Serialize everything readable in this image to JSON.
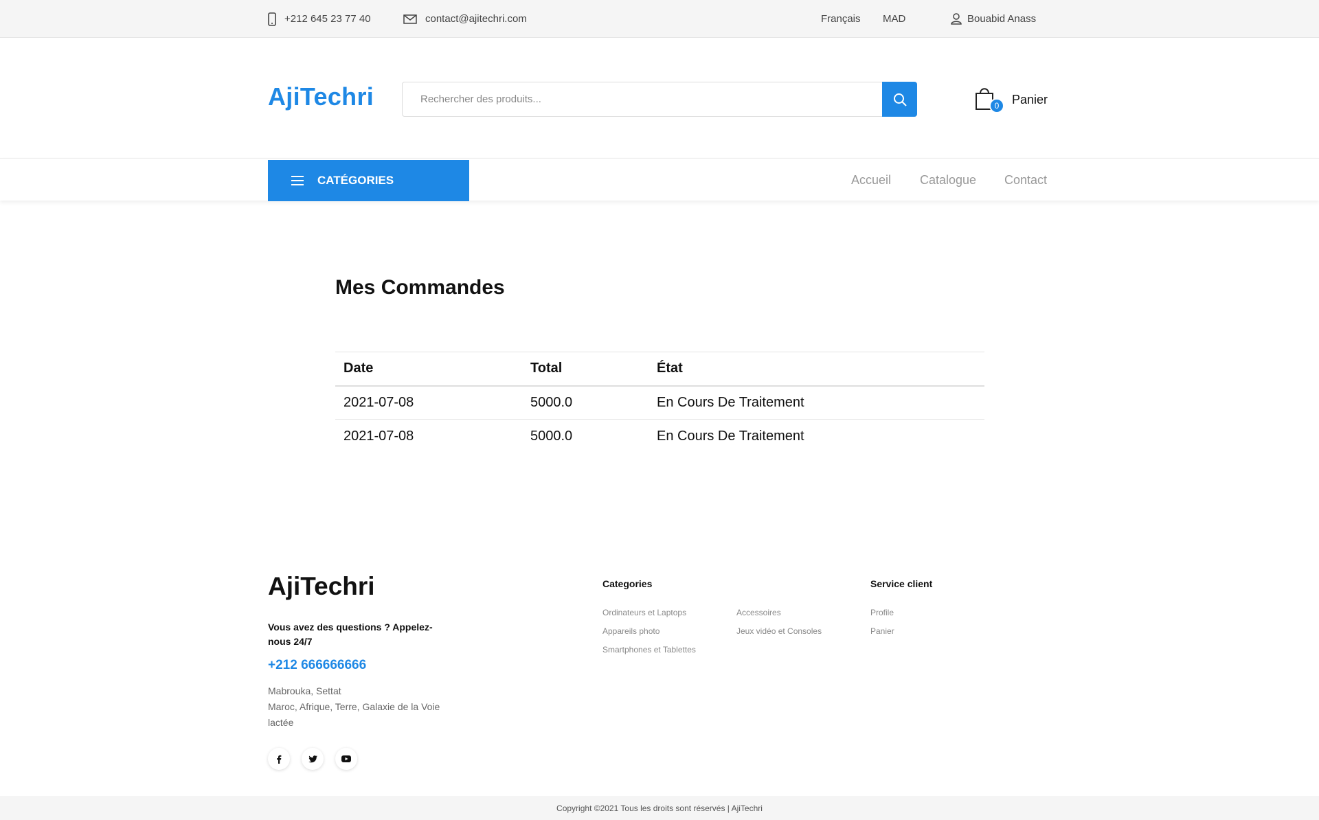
{
  "topbar": {
    "phone": "+212 645 23 77 40",
    "email": "contact@ajitechri.com",
    "language": "Français",
    "currency": "MAD",
    "user": "Bouabid Anass"
  },
  "header": {
    "logo": "AjiTechri",
    "search_placeholder": "Rechercher des produits...",
    "cart_count": "0",
    "cart_label": "Panier"
  },
  "nav": {
    "categories": "CATÉGORIES",
    "links": [
      "Accueil",
      "Catalogue",
      "Contact"
    ]
  },
  "main": {
    "title": "Mes Commandes",
    "columns": [
      "Date",
      "Total",
      "État"
    ],
    "rows": [
      [
        "2021-07-08",
        "5000.0",
        "En Cours De Traitement"
      ],
      [
        "2021-07-08",
        "5000.0",
        "En Cours De Traitement"
      ]
    ]
  },
  "footer": {
    "logo": "AjiTechri",
    "question": "Vous avez des questions ? Appelez-nous 24/7",
    "phone": "+212 666666666",
    "address_line1": "Mabrouka, Settat",
    "address_line2": "Maroc, Afrique, Terre, Galaxie de la Voie lactée",
    "categories_title": "Categories",
    "categories": [
      "Ordinateurs et Laptops",
      "Accessoires",
      "Appareils photo",
      "Jeux vidéo et Consoles",
      "Smartphones et Tablettes"
    ],
    "service_title": "Service client",
    "service_links": [
      "Profile",
      "Panier"
    ],
    "social": [
      "facebook-icon",
      "twitter-icon",
      "youtube-icon"
    ],
    "copyright": "Copyright ©2021 Tous les droits sont réservés | AjiTechri"
  },
  "colors": {
    "accent": "#1e88e5",
    "topbar_bg": "#f5f5f5"
  }
}
